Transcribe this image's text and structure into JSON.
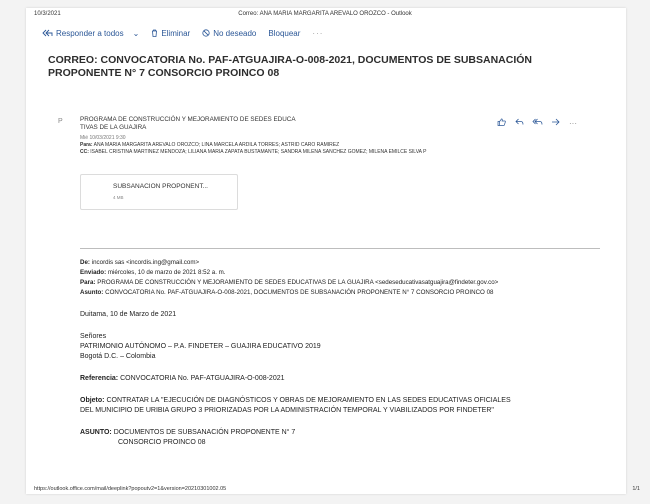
{
  "print": {
    "date": "10/3/2021",
    "title": "Correo: ANA MARIA MARGARITA AREVALO OROZCO - Outlook",
    "url": "https://outlook.office.com/mail/deeplink?popoutv2=1&version=20210301002.05",
    "page": "1/1"
  },
  "toolbar": {
    "reply_all": "Responder a todos",
    "delete": "Eliminar",
    "junk": "No deseado",
    "block": "Bloquear",
    "more": "···"
  },
  "subject": "CORREO: CONVOCATORIA No. PAF-ATGUAJIRA-O-008-2021, DOCUMENTOS DE SUBSANACIÓN PROPONENTE N° 7 CONSORCIO PROINCO 08",
  "message": {
    "avatar": "P",
    "sender_line1": "PROGRAMA DE CONSTRUCCIÓN Y MEJORAMIENTO DE SEDES EDUCA",
    "sender_line2": "TIVAS DE LA GUAJIRA",
    "date": "Mié 10/03/2021 9:30",
    "to_label": "Para:",
    "to": "ANA MARIA MARGARITA AREVALO OROZCO; LINA MARCELA ARDILA TORRES; ASTRID CARO RAMIREZ",
    "cc_label": "CC:",
    "cc": "ISABEL CRISTINA MARTINEZ MENDOZA; LILIANA MARIA ZAPATA BUSTAMANTE; SANDRA MILENA SANCHEZ GOMEZ; MILENA EMILCE SILVA P",
    "actions_more": "···"
  },
  "attachment": {
    "name": "SUBSANACION PROPONENT...",
    "size": "4 MB"
  },
  "body": {
    "de_label": "De:",
    "de": "incordis sas <incordis.ing@gmail.com>",
    "enviado_label": "Enviado:",
    "enviado": "miércoles, 10 de marzo de 2021 8:52 a. m.",
    "para_label": "Para:",
    "para": "PROGRAMA DE CONSTRUCCIÓN Y MEJORAMIENTO DE SEDES EDUCATIVAS DE LA GUAJIRA <sedeseducativasatguajira@findeter.gov.co>",
    "asunto_label": "Asunto:",
    "asunto": "CONVOCATORIA No. PAF-ATGUAJIRA-O-008-2021, DOCUMENTOS DE SUBSANACIÓN PROPONENTE N° 7 CONSORCIO PROINCO 08",
    "city_date": "Duitama, 10 de Marzo de 2021",
    "senores": "Señores",
    "patrimonio": "PATRIMONIO AUTÓNOMO – P.A. FINDETER – GUAJIRA EDUCATIVO 2019",
    "bogota": "Bogotá D.C. – Colombia",
    "referencia_label": "Referencia:",
    "referencia": "CONVOCATORIA No. PAF-ATGUAJIRA-O-008-2021",
    "objeto_label": "Objeto:",
    "objeto_line1": "CONTRATAR LA \"EJECUCIÓN DE DIAGNÓSTICOS Y OBRAS DE MEJORAMIENTO EN LAS SEDES EDUCATIVAS OFICIALES",
    "objeto_line2": "DEL MUNICIPIO DE URIBIA GRUPO 3 PRIORIZADAS POR LA ADMINISTRACIÓN TEMPORAL Y VIABILIZADOS POR FINDETER\"",
    "asunto2_label": "ASUNTO:",
    "asunto2_line1": "DOCUMENTOS DE SUBSANACIÓN PROPONENTE N° 7",
    "asunto2_line2": "CONSORCIO PROINCO 08"
  },
  "colors": {
    "accent": "#2b5797",
    "text": "#1f1f1f"
  }
}
